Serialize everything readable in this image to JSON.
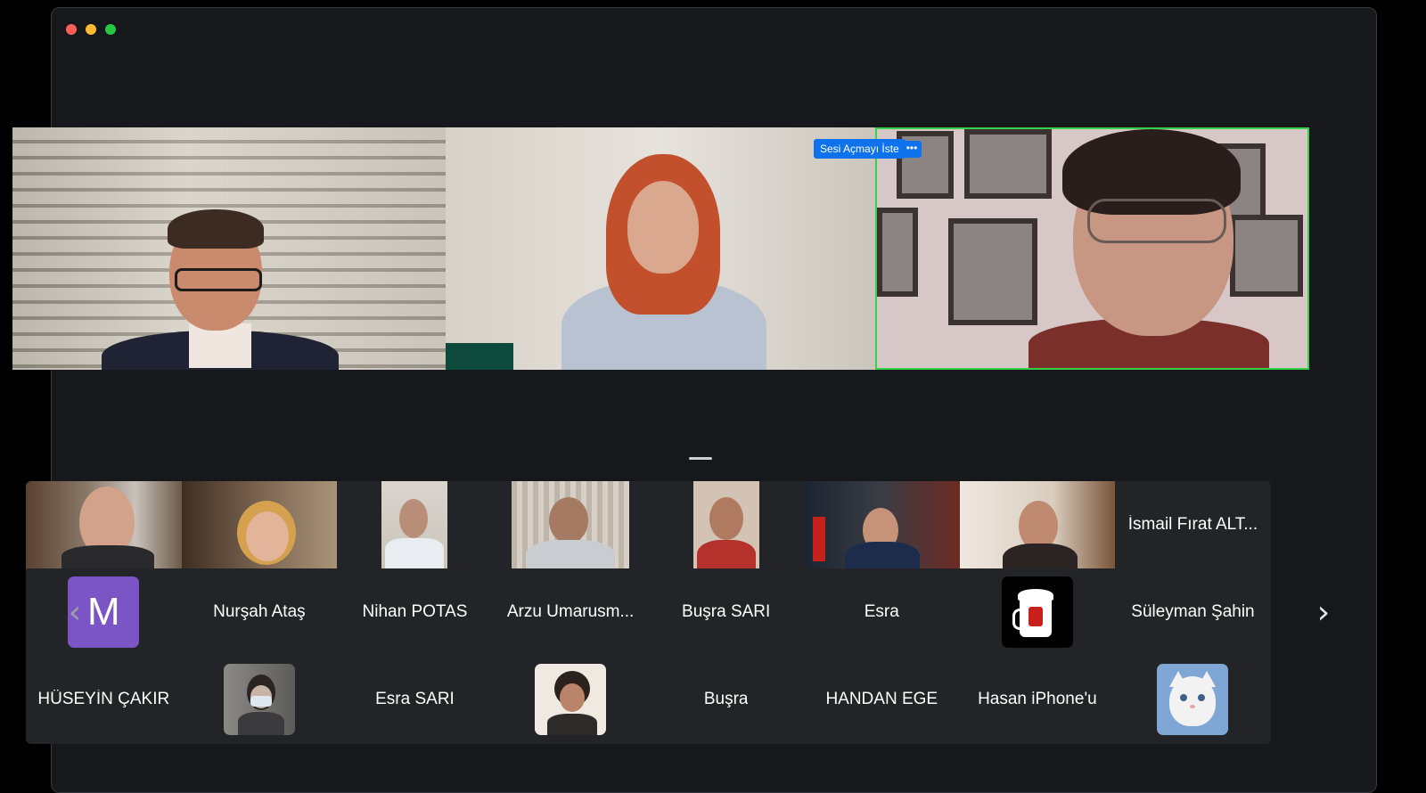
{
  "window": {
    "traffic_lights": [
      "close",
      "minimize",
      "zoom"
    ]
  },
  "speaker_view": {
    "active_speaker_border_color": "#36d24a",
    "unmute_request_label": "Sesi Açmayı İste",
    "more_label": "•••"
  },
  "gallery": {
    "row1": [
      {
        "type": "video"
      },
      {
        "type": "video"
      },
      {
        "type": "video"
      },
      {
        "type": "video"
      },
      {
        "type": "video"
      },
      {
        "type": "video"
      },
      {
        "type": "video"
      },
      {
        "type": "name",
        "name": "İsmail Fırat ALT..."
      }
    ],
    "row2": [
      {
        "type": "avatar-letter",
        "letter": "M"
      },
      {
        "type": "name",
        "name": "Nurşah Ataş"
      },
      {
        "type": "name",
        "name": "Nihan POTAS"
      },
      {
        "type": "name",
        "name": "Arzu Umarusm..."
      },
      {
        "type": "name",
        "name": "Buşra SARI"
      },
      {
        "type": "name",
        "name": "Esra"
      },
      {
        "type": "avatar-image",
        "icon": "mug-icon"
      },
      {
        "type": "name",
        "name": "Süleyman Şahin"
      }
    ],
    "row3": [
      {
        "type": "name",
        "name": "HÜSEYİN ÇAKIR"
      },
      {
        "type": "avatar-image",
        "icon": "person-photo"
      },
      {
        "type": "name",
        "name": "Esra SARI"
      },
      {
        "type": "avatar-image",
        "icon": "person-photo"
      },
      {
        "type": "name",
        "name": "Buşra"
      },
      {
        "type": "name",
        "name": "HANDAN EGE"
      },
      {
        "type": "name",
        "name": "Hasan iPhone'u"
      },
      {
        "type": "avatar-image",
        "icon": "cat-icon"
      }
    ],
    "prev_arrow": "‹",
    "next_arrow": "›"
  }
}
